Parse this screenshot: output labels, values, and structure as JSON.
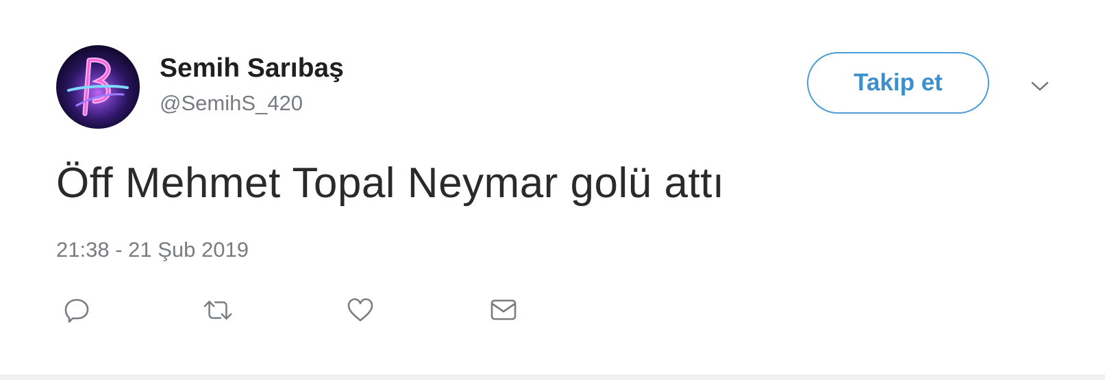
{
  "user": {
    "display_name": "Semih Sarıbaş",
    "handle": "@SemihS_420",
    "avatar_icon": "avatar-neon-letter-icon"
  },
  "follow_button": {
    "label": "Takip et",
    "color": "#4a9bd6"
  },
  "tweet": {
    "text": "Öff Mehmet Topal Neymar golü attı",
    "timestamp": "21:38 - 21 Şub 2019"
  },
  "actions": [
    {
      "name": "reply",
      "icon": "reply-icon"
    },
    {
      "name": "retweet",
      "icon": "retweet-icon"
    },
    {
      "name": "like",
      "icon": "heart-icon"
    },
    {
      "name": "direct-message",
      "icon": "envelope-icon"
    }
  ],
  "more_menu": {
    "icon": "chevron-down-icon"
  }
}
